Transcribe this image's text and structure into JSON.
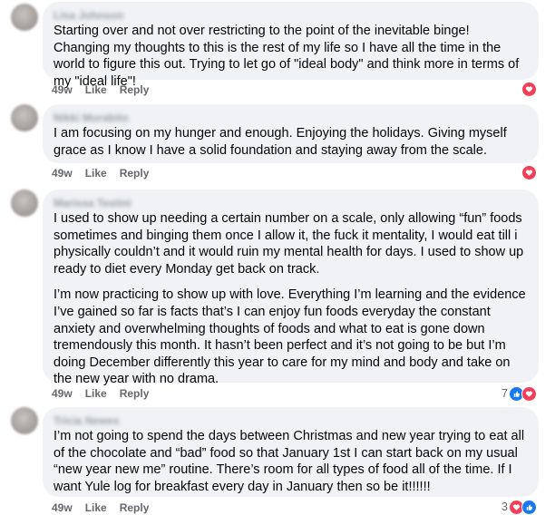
{
  "comments": [
    {
      "author": "Lisa Johnson",
      "paragraphs": [
        "Starting over and not over restricting to the point of the inevitable binge! Changing my thoughts to this is the rest of my life so I have all the time in the world to figure this out. Trying to let go of \"ideal body\" and think more in terms of my \"ideal life\"!"
      ],
      "age": "49w",
      "like_label": "Like",
      "reply_label": "Reply",
      "reactions": [
        "heart"
      ],
      "reaction_count": ""
    },
    {
      "author": "Nikki Morabito",
      "paragraphs": [
        "I am focusing on my hunger and enough. Enjoying the holidays. Giving myself grace as I know I have a solid foundation and staying away from the scale."
      ],
      "age": "49w",
      "like_label": "Like",
      "reply_label": "Reply",
      "reactions": [
        "heart"
      ],
      "reaction_count": ""
    },
    {
      "author": "Marissa Testini",
      "paragraphs": [
        "I used to show up needing a certain number on a scale, only allowing “fun” foods sometimes and binging them once I allow it, the fuck it mentality, I would eat till i physically couldn’t and it would ruin my mental health for days. I used to show up ready to diet every Monday get back on track.",
        "I’m now practicing to show up with love. Everything I’m learning and the evidence I’ve gained so far is facts that’s I can enjoy fun foods everyday the constant anxiety and overwhelming thoughts of foods and what to eat is gone down tremendously this month. It hasn’t been perfect and it’s not going to be but I’m doing December differently this year to care for my mind and body and take on the new year with no drama."
      ],
      "age": "49w",
      "like_label": "Like",
      "reply_label": "Reply",
      "reactions": [
        "like",
        "heart"
      ],
      "reaction_count": "7"
    },
    {
      "author": "Tricia Newes",
      "paragraphs": [
        "I’m not going to spend the days between Christmas and new year trying to eat all of the chocolate and “bad” food so that January 1st I can start back on my usual “new year new me” routine. There’s room for all types of food all of the time. If I want Yule log for breakfast every day in January then so be it!!!!!!"
      ],
      "age": "49w",
      "like_label": "Like",
      "reply_label": "Reply",
      "reactions": [
        "heart",
        "like"
      ],
      "reaction_count": "3"
    }
  ],
  "colors": {
    "bubble": "#f0f2f5",
    "meta_text": "#65676b",
    "heart": "#f33e58",
    "like": "#1877f2"
  }
}
